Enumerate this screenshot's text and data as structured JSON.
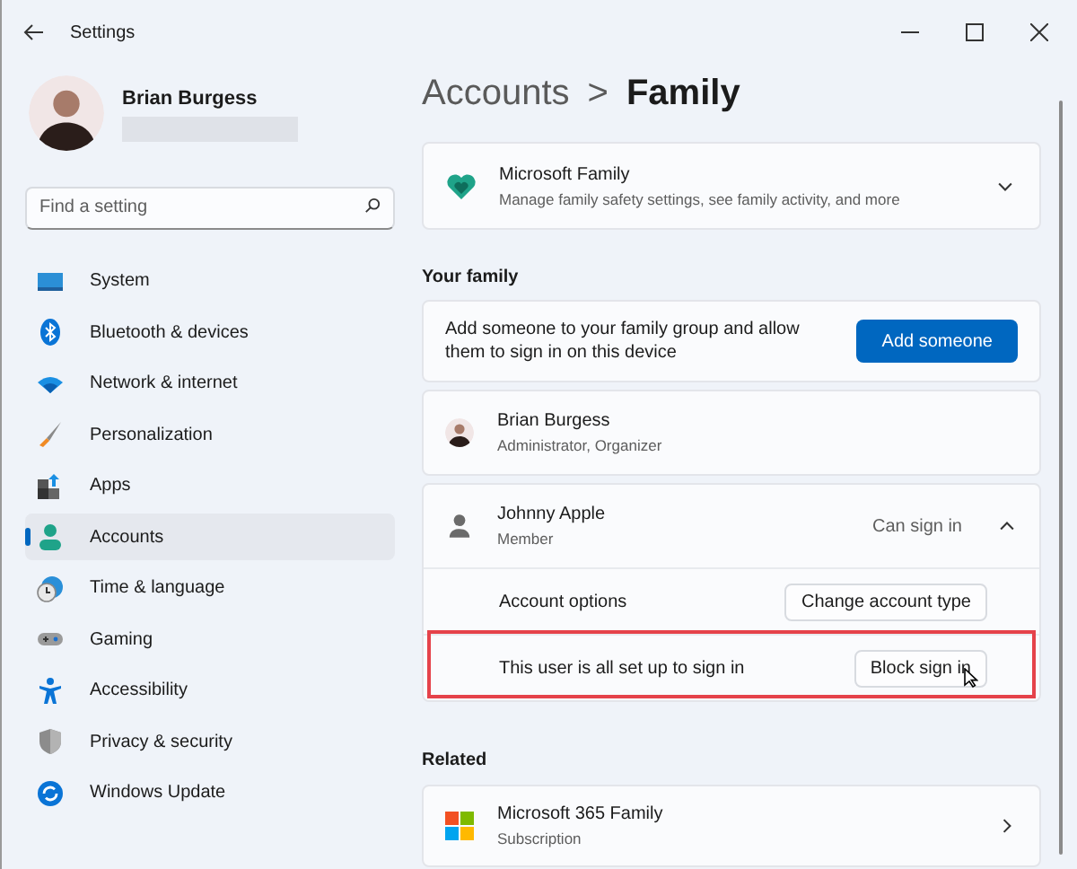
{
  "window": {
    "title": "Settings"
  },
  "profile": {
    "name": "Brian Burgess"
  },
  "search": {
    "placeholder": "Find a setting"
  },
  "sidebar": {
    "items": [
      {
        "label": "System",
        "selected": false
      },
      {
        "label": "Bluetooth & devices",
        "selected": false
      },
      {
        "label": "Network & internet",
        "selected": false
      },
      {
        "label": "Personalization",
        "selected": false
      },
      {
        "label": "Apps",
        "selected": false
      },
      {
        "label": "Accounts",
        "selected": true
      },
      {
        "label": "Time & language",
        "selected": false
      },
      {
        "label": "Gaming",
        "selected": false
      },
      {
        "label": "Accessibility",
        "selected": false
      },
      {
        "label": "Privacy & security",
        "selected": false
      },
      {
        "label": "Windows Update",
        "selected": false
      }
    ]
  },
  "breadcrumb": {
    "parent": "Accounts",
    "separator": ">",
    "current": "Family"
  },
  "microsoft_family": {
    "title": "Microsoft Family",
    "subtitle": "Manage family safety settings, see family activity, and more",
    "expanded": false
  },
  "your_family": {
    "heading": "Your family",
    "add_text": "Add someone to your family group and allow them to sign in on this device",
    "add_button": "Add someone",
    "members": [
      {
        "name": "Brian Burgess",
        "role": "Administrator, Organizer"
      },
      {
        "name": "Johnny Apple",
        "role": "Member",
        "status": "Can sign in",
        "expanded": true,
        "options": [
          {
            "label": "Account options",
            "button": "Change account type",
            "highlighted": false
          },
          {
            "label": "This user is all set up to sign in",
            "button": "Block sign in",
            "highlighted": true
          }
        ]
      }
    ]
  },
  "related": {
    "heading": "Related",
    "items": [
      {
        "title": "Microsoft 365 Family",
        "subtitle": "Subscription"
      }
    ]
  }
}
